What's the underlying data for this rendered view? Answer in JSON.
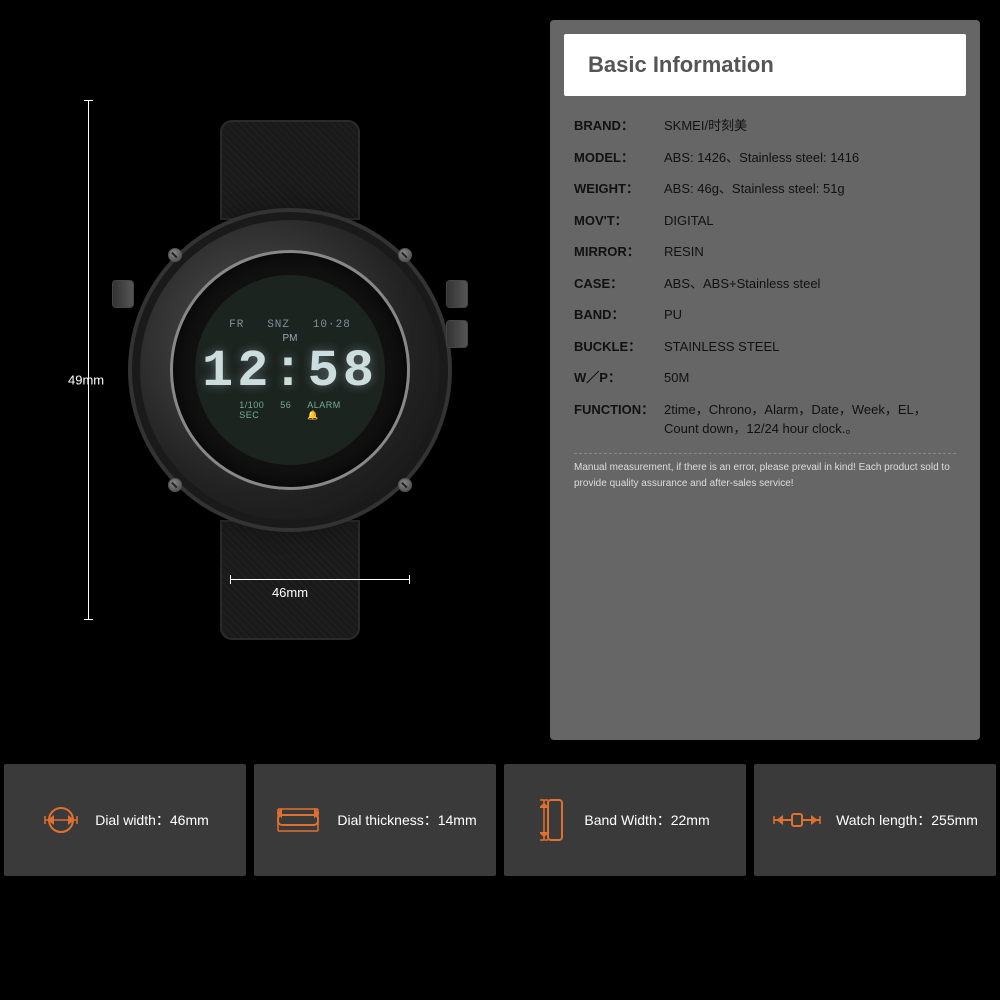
{
  "info": {
    "title": "Basic Information",
    "rows": [
      {
        "label": "BRAND：",
        "value": "SKMEI/时刻美"
      },
      {
        "label": "MODEL：",
        "value": "ABS: 1426、Stainless steel: 1416"
      },
      {
        "label": "WEIGHT：",
        "value": "ABS: 46g、Stainless steel: 51g"
      },
      {
        "label": "MOV'T：",
        "value": "DIGITAL"
      },
      {
        "label": "MIRROR：",
        "value": "RESIN"
      },
      {
        "label": "CASE：",
        "value": "ABS、ABS+Stainless steel"
      },
      {
        "label": "BAND：",
        "value": "PU"
      },
      {
        "label": "BUCKLE：",
        "value": "STAINLESS STEEL"
      },
      {
        "label": "W／P：",
        "value": "50M"
      },
      {
        "label": "FUNCTION：",
        "value": "2time，Chrono，Alarm，Date，Week，EL，Count down，12/24 hour clock.。"
      }
    ],
    "note": "Manual measurement, if there is an error, please prevail in kind!\nEach product sold to provide quality assurance and after-sales service!"
  },
  "watch": {
    "lcd_top": "FR  SNZ",
    "lcd_date": "10·28",
    "lcd_pm": "PM",
    "lcd_time": "12:58",
    "lcd_bottom_left": "1/100\nSEC",
    "lcd_bottom_right": "ALARM",
    "lcd_seconds": "56"
  },
  "dimensions": {
    "height_label": "49mm",
    "width_label": "46mm"
  },
  "specs": [
    {
      "icon": "dial-width",
      "label": "Dial width：46mm"
    },
    {
      "icon": "dial-thickness",
      "label": "Dial thickness：14mm"
    },
    {
      "icon": "band-width",
      "label": "Band Width：22mm"
    },
    {
      "icon": "watch-length",
      "label": "Watch length：255mm"
    }
  ]
}
